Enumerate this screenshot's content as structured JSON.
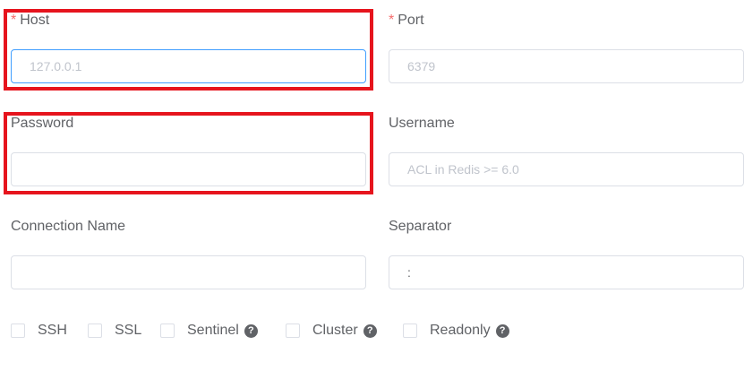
{
  "form": {
    "host": {
      "required_mark": "*",
      "label": "Host",
      "placeholder": "127.0.0.1",
      "value": ""
    },
    "port": {
      "required_mark": "*",
      "label": "Port",
      "placeholder": "6379",
      "value": ""
    },
    "password": {
      "label": "Password",
      "placeholder": "",
      "value": ""
    },
    "username": {
      "label": "Username",
      "placeholder": "ACL in Redis >= 6.0",
      "value": ""
    },
    "connection_name": {
      "label": "Connection Name",
      "placeholder": "",
      "value": ""
    },
    "separator": {
      "label": "Separator",
      "placeholder": "",
      "value": ":"
    }
  },
  "options": {
    "ssh": {
      "label": "SSH",
      "checked": false
    },
    "ssl": {
      "label": "SSL",
      "checked": false
    },
    "sentinel": {
      "label": "Sentinel",
      "help_icon": "?",
      "checked": false
    },
    "cluster": {
      "label": "Cluster",
      "help_icon": "?",
      "checked": false
    },
    "readonly": {
      "label": "Readonly",
      "help_icon": "?",
      "checked": false
    }
  },
  "colors": {
    "highlight": "#e6141d",
    "required": "#f56c6c",
    "focus_border": "#409eff"
  }
}
